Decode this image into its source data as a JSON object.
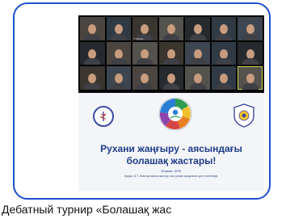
{
  "slide": {
    "title_line1": "Рухани жаңғыру - аясындағы",
    "title_line2": "болашақ жастары!",
    "format": "Формат: АПФ",
    "note": "Қарар: Б.Т. Жастар мына жастар осы ұлғаю жаңалығы деп есептейді."
  },
  "caption": "Дебатный турнир «Болашақ жас",
  "participants": [
    "",
    "",
    "T. Мусан...",
    "",
    "",
    "",
    "",
    "",
    "",
    "",
    "",
    "",
    "",
    "",
    "",
    "",
    "",
    "",
    "",
    "",
    ""
  ],
  "colors": {
    "frame_border": "#1c4fd0",
    "title": "#1d3c8a",
    "active_speaker": "#c9d84a"
  }
}
